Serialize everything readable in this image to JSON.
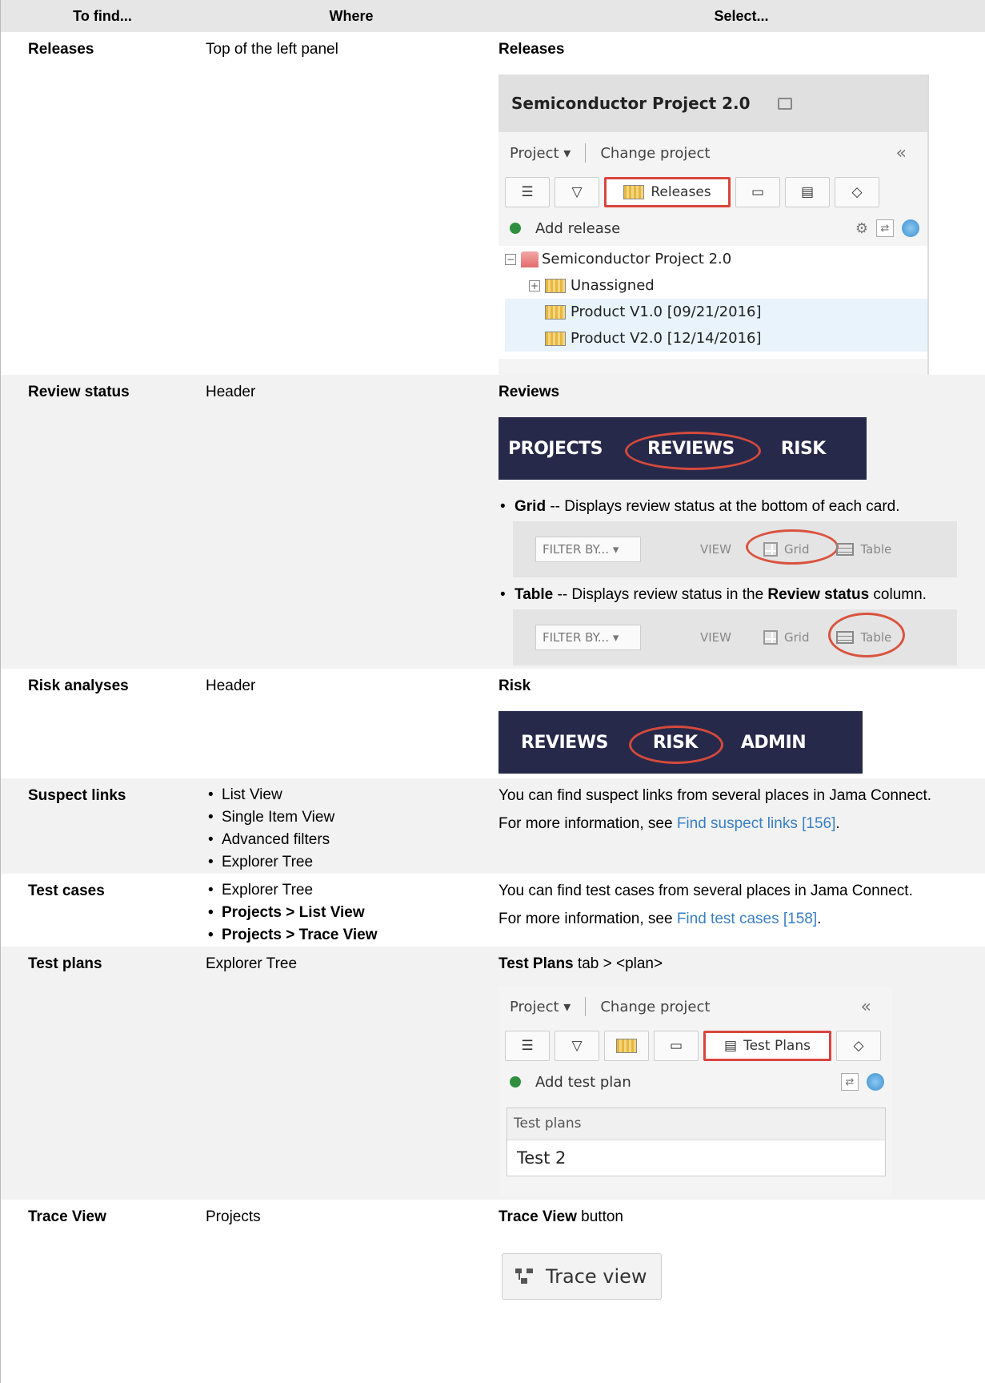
{
  "headers": [
    "To find...",
    "Where",
    "Select..."
  ],
  "rows": {
    "releases": {
      "find": "Releases",
      "where": "Top of the left panel",
      "select": "Releases",
      "shot": {
        "project_title": "Semiconductor Project 2.0",
        "project_menu": "Project ▾",
        "change_project": "Change project",
        "collapse": "«",
        "selected_tab": "Releases",
        "add_label": "Add release",
        "tree_root": "Semiconductor Project 2.0",
        "tree_items": [
          "Unassigned",
          "Product V1.0 [09/21/2016]",
          "Product V2.0 [12/14/2016]"
        ]
      }
    },
    "review": {
      "find": "Review status",
      "where": "Header",
      "select": "Reviews",
      "nav": [
        "PROJECTS",
        "REVIEWS",
        "RISK"
      ],
      "grid_b": "Grid",
      "grid_text": " -- Displays review status at the bottom of each card.",
      "table_b": "Table",
      "table_text1": " -- Displays review status in the ",
      "table_b2": "Review status",
      "table_text2": " column.",
      "filter": "FILTER BY... ▾",
      "view": "VIEW",
      "grid_lbl": "Grid",
      "table_lbl": "Table"
    },
    "risk": {
      "find": "Risk analyses",
      "where": "Header",
      "select": "Risk",
      "nav": [
        "REVIEWS",
        "RISK",
        "ADMIN"
      ]
    },
    "suspect": {
      "find": "Suspect links",
      "where": [
        "List View",
        "Single Item View",
        "Advanced filters",
        "Explorer Tree"
      ],
      "text1": "You can find suspect links from several places in Jama Connect.",
      "text2": "For more information, see ",
      "link": "Find suspect links [156]",
      "end": "."
    },
    "testcases": {
      "find": "Test cases",
      "where": [
        "Explorer Tree",
        "Projects > List View",
        "Projects > Trace View"
      ],
      "text1": "You can find test cases from several places in Jama Connect.",
      "text2": "For more information, see ",
      "link": "Find test cases [158]",
      "end": "."
    },
    "testplans": {
      "find": "Test plans",
      "where": "Explorer Tree",
      "select_b": "Test Plans",
      "select_rest": " tab > <plan>",
      "shot": {
        "project_menu": "Project ▾",
        "change_project": "Change project",
        "collapse": "«",
        "selected_tab": "Test Plans",
        "add_label": "Add test plan",
        "table_header": "Test plans",
        "table_row": "Test 2"
      }
    },
    "trace": {
      "find": "Trace View",
      "where": "Projects",
      "select_b": "Trace View",
      "select_rest": " button",
      "button": "Trace view"
    }
  }
}
